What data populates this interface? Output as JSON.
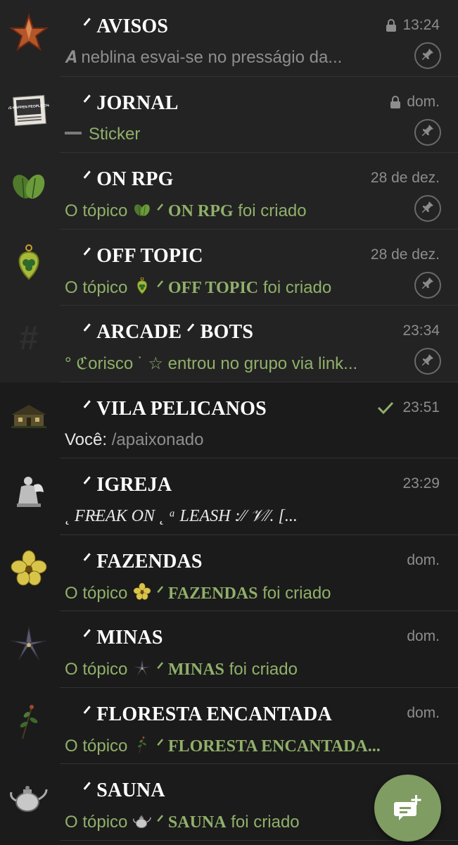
{
  "chats": [
    {
      "title": "ᐟ AVISOS",
      "time": "13:24",
      "locked": true,
      "pinned": true,
      "preview": {
        "kind": "gray",
        "text": "𝑨 neblina esvai-se no presságio da..."
      },
      "avatar_icon": "star-icon"
    },
    {
      "title": "ᐟ JORNAL",
      "time": "dom.",
      "locked": true,
      "pinned": true,
      "preview": {
        "kind": "sticker",
        "text": "Sticker"
      },
      "avatar_icon": "newspaper-icon",
      "avatar_text": "THINGS HAPPEN PEOPLE CHANGE"
    },
    {
      "title": "ᐟ ON RPG",
      "time": "28 de dez.",
      "locked": false,
      "pinned": true,
      "preview": {
        "kind": "topic",
        "prefix": "O tópico",
        "name": "ᐟ ON RPG",
        "suffix": "foi criado"
      },
      "avatar_icon": "leaves-icon"
    },
    {
      "title": "ᐟ OFF TOPIC",
      "time": "28 de dez.",
      "locked": false,
      "pinned": true,
      "preview": {
        "kind": "topic",
        "prefix": "O tópico",
        "name": "ᐟ OFF TOPIC",
        "suffix": "foi criado"
      },
      "avatar_icon": "clover-locket-icon"
    },
    {
      "title": "ᐟ ARCADE ᐟ BOTS",
      "time": "23:34",
      "locked": false,
      "pinned": true,
      "preview": {
        "kind": "green",
        "text": "° ℭorisco ˙ ☆ entrou no grupo via link..."
      },
      "avatar_icon": "hashtag-icon"
    },
    {
      "title": "ᐟ VILA PELICANOS",
      "time": "23:51",
      "locked": false,
      "pinned": false,
      "read": true,
      "preview": {
        "kind": "sender",
        "sender": "Você:",
        "text": "/apaixonado"
      },
      "avatar_icon": "house-icon"
    },
    {
      "title": "ᐟ IGREJA",
      "time": "23:29",
      "locked": false,
      "pinned": false,
      "preview": {
        "kind": "stylized",
        "text": "˛ FR̶EAK ON ˛ ᵃ LEASH  :⁄⁄ 𝒱⁄⁄. [..."
      },
      "avatar_icon": "angel-statue-icon"
    },
    {
      "title": "ᐟ FAZENDAS",
      "time": "dom.",
      "locked": false,
      "pinned": false,
      "preview": {
        "kind": "topic",
        "prefix": "O tópico",
        "name": "ᐟ FAZENDAS",
        "suffix": "foi criado"
      },
      "avatar_icon": "yellow-flower-icon"
    },
    {
      "title": "ᐟ MINAS",
      "time": "dom.",
      "locked": false,
      "pinned": false,
      "preview": {
        "kind": "topic",
        "prefix": "O tópico",
        "name": "ᐟ MINAS",
        "suffix": "foi criado"
      },
      "avatar_icon": "dark-flower-icon"
    },
    {
      "title": "ᐟ FLORESTA ENCANTADA",
      "time": "dom.",
      "locked": false,
      "pinned": false,
      "preview": {
        "kind": "topic",
        "prefix": "O tópico",
        "name": "ᐟ FLORESTA ENCANTADA...",
        "suffix": ""
      },
      "avatar_icon": "sprig-icon"
    },
    {
      "title": "ᐟ SAUNA",
      "time": "",
      "locked": false,
      "pinned": false,
      "preview": {
        "kind": "topic",
        "prefix": "O tópico",
        "name": "ᐟ SAUNA",
        "suffix": "foi criado"
      },
      "avatar_icon": "teapot-icon"
    }
  ],
  "fab": {
    "icon": "new-message-icon"
  },
  "colors": {
    "accent": "#90b06a",
    "fab": "#7f9c63",
    "pinned_bg": "#232323",
    "bg": "#1b1b1b",
    "meta": "#8d8d8d"
  }
}
